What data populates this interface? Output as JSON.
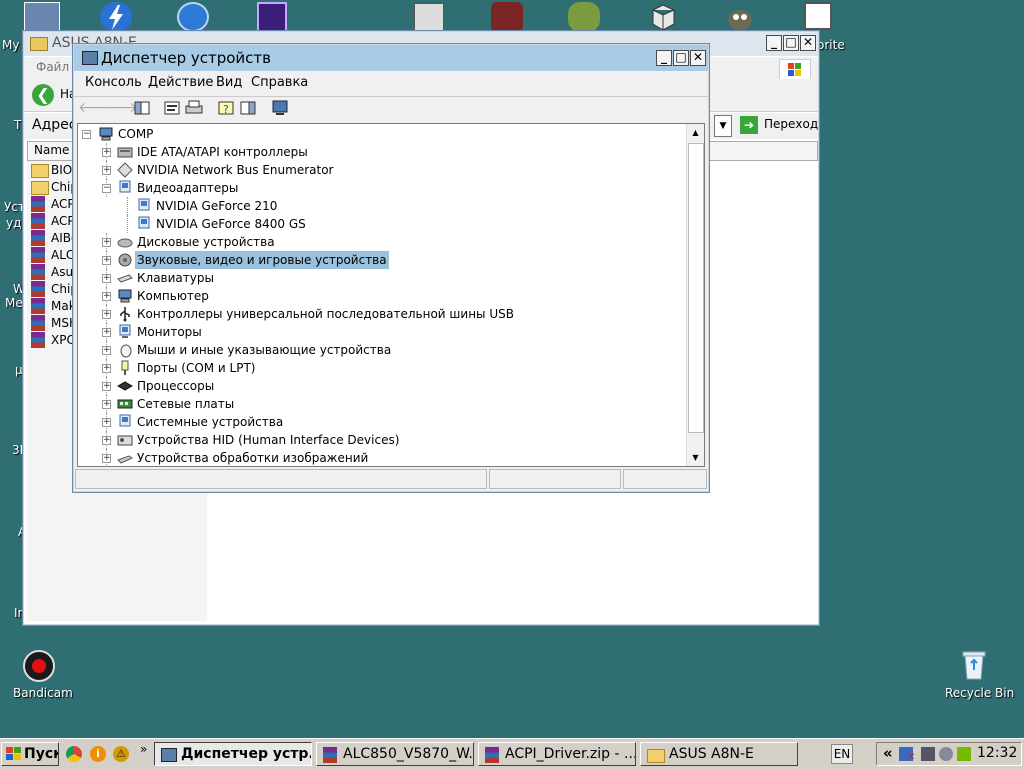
{
  "desktop": {
    "left_fragments": [
      "My",
      "Т",
      "Уст",
      "уда",
      "W",
      "Ме",
      "µ",
      "3D",
      "А",
      "In"
    ],
    "right_fragment": "orite",
    "icons": [
      {
        "label": "Bandicam",
        "icon": "bandicam-icon"
      },
      {
        "label": "Recycle Bin",
        "icon": "recycle-bin-icon"
      }
    ]
  },
  "explorer": {
    "title": "ASUS A8N-E",
    "menu_first": "Файл",
    "back_label": "На",
    "address_label": "Адрес",
    "go_label": "Переход",
    "column_name": "Name",
    "files": [
      "BIOS",
      "Chip",
      "ACP",
      "ACP",
      "AIBo",
      "ALC",
      "Asu",
      "Chip",
      "Mak",
      "MSH",
      "XPC"
    ]
  },
  "devmgr": {
    "title": "Диспетчер устройств",
    "menu": [
      "Консоль",
      "Действие",
      "Вид",
      "Справка"
    ],
    "root": "COMP",
    "nodes": [
      {
        "label": "IDE ATA/ATAPI контроллеры",
        "icon": "ide-controller-icon",
        "expanded": false
      },
      {
        "label": "NVIDIA Network Bus Enumerator",
        "icon": "network-bus-icon",
        "expanded": false
      },
      {
        "label": "Видеоадаптеры",
        "icon": "display-adapter-icon",
        "expanded": true
      },
      {
        "label": "NVIDIA GeForce 210",
        "icon": "display-adapter-icon",
        "child": true
      },
      {
        "label": "NVIDIA GeForce 8400 GS",
        "icon": "display-adapter-icon",
        "child": true
      },
      {
        "label": "Дисковые устройства",
        "icon": "disk-drive-icon",
        "expanded": false
      },
      {
        "label": "Звуковые, видео и игровые устройства",
        "icon": "sound-device-icon",
        "expanded": false,
        "selected": true
      },
      {
        "label": "Клавиатуры",
        "icon": "keyboard-icon",
        "expanded": false
      },
      {
        "label": "Компьютер",
        "icon": "computer-icon",
        "expanded": false
      },
      {
        "label": "Контроллеры универсальной последовательной шины USB",
        "icon": "usb-icon",
        "expanded": false
      },
      {
        "label": "Мониторы",
        "icon": "monitor-icon",
        "expanded": false
      },
      {
        "label": "Мыши и иные указывающие устройства",
        "icon": "mouse-icon",
        "expanded": false
      },
      {
        "label": "Порты (COM и LPT)",
        "icon": "port-icon",
        "expanded": false
      },
      {
        "label": "Процессоры",
        "icon": "processor-icon",
        "expanded": false
      },
      {
        "label": "Сетевые платы",
        "icon": "network-card-icon",
        "expanded": false
      },
      {
        "label": "Системные устройства",
        "icon": "system-device-icon",
        "expanded": false
      },
      {
        "label": "Устройства HID (Human Interface Devices)",
        "icon": "hid-icon",
        "expanded": false
      },
      {
        "label": "Устройства обработки изображений",
        "icon": "imaging-device-icon",
        "expanded": false
      }
    ]
  },
  "taskbar": {
    "start_label": "Пуск",
    "tasks": [
      {
        "label": "Диспетчер устр...",
        "icon": "device-manager-icon",
        "active": true
      },
      {
        "label": "ALC850_V5870_W...",
        "icon": "winrar-icon"
      },
      {
        "label": "ACPI_Driver.zip - ...",
        "icon": "winrar-icon"
      },
      {
        "label": "ASUS A8N-E",
        "icon": "folder-icon"
      }
    ],
    "lang": "EN",
    "chevron": "«",
    "clock": "12:32"
  },
  "colors": {
    "desktop": "#2f6f73",
    "titlebar_active": "#a8cbe6",
    "selection": "#9ac0dc",
    "taskbar": "#d4d0c8"
  }
}
